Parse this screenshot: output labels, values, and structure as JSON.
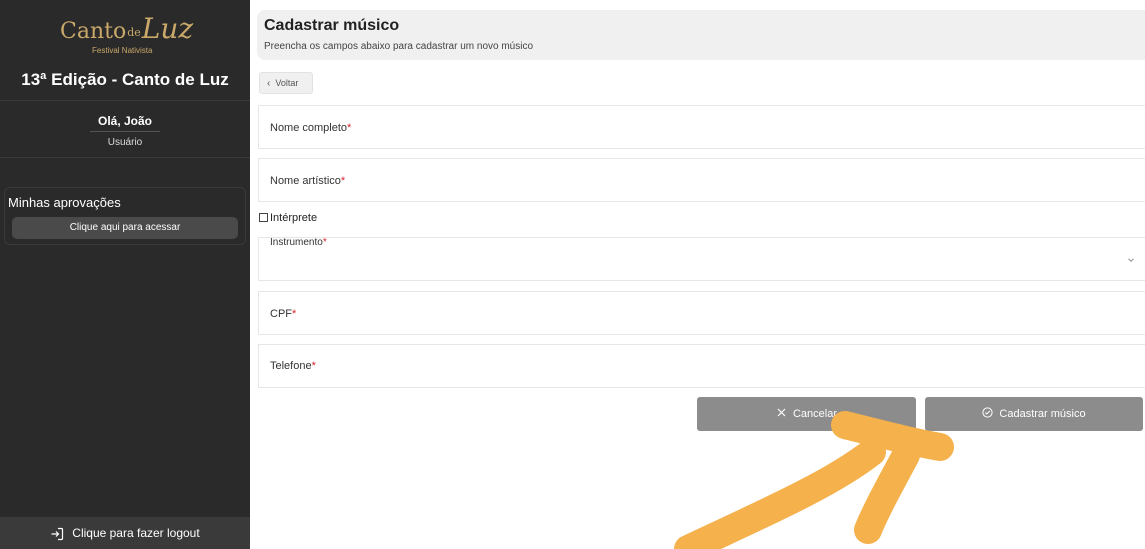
{
  "sidebar": {
    "logo": {
      "canto": "Canto",
      "de": "de",
      "luz": "Luz",
      "subtitle": "Festival Nativista"
    },
    "edition_title": "13ª Edição - Canto de Luz",
    "greeting": "Olá, João",
    "role": "Usuário",
    "approvals": {
      "title": "Minhas aprovações",
      "button_label": "Clique aqui para acessar"
    },
    "logout_label": "Clique para fazer logout"
  },
  "header": {
    "title": "Cadastrar músico",
    "subtitle": "Preencha os campos abaixo para cadastrar um novo músico"
  },
  "back_button": {
    "label": "Voltar"
  },
  "form": {
    "full_name": {
      "label": "Nome completo",
      "required_mark": "*"
    },
    "artistic_name": {
      "label": "Nome artístico",
      "required_mark": "*"
    },
    "interpreter_checkbox": {
      "label": "Intérprete",
      "checked": false
    },
    "instrument": {
      "label": "Instrumento",
      "required_mark": "*"
    },
    "cpf": {
      "label": "CPF",
      "required_mark": "*"
    },
    "phone": {
      "label": "Telefone",
      "required_mark": "*"
    }
  },
  "actions": {
    "cancel_label": "Cancelar",
    "submit_label": "Cadastrar músico"
  },
  "colors": {
    "sidebar_bg": "#2a2a2a",
    "logo_gold": "#c9a86a",
    "required": "#d6232d",
    "button_gray": "#8c8c8c",
    "annotation_arrow": "#f5b14c"
  },
  "icons": {
    "logout": "logout-icon",
    "back": "chevron-left-icon",
    "select": "chevron-down-icon",
    "cancel": "close-icon",
    "submit": "check-circle-icon"
  }
}
